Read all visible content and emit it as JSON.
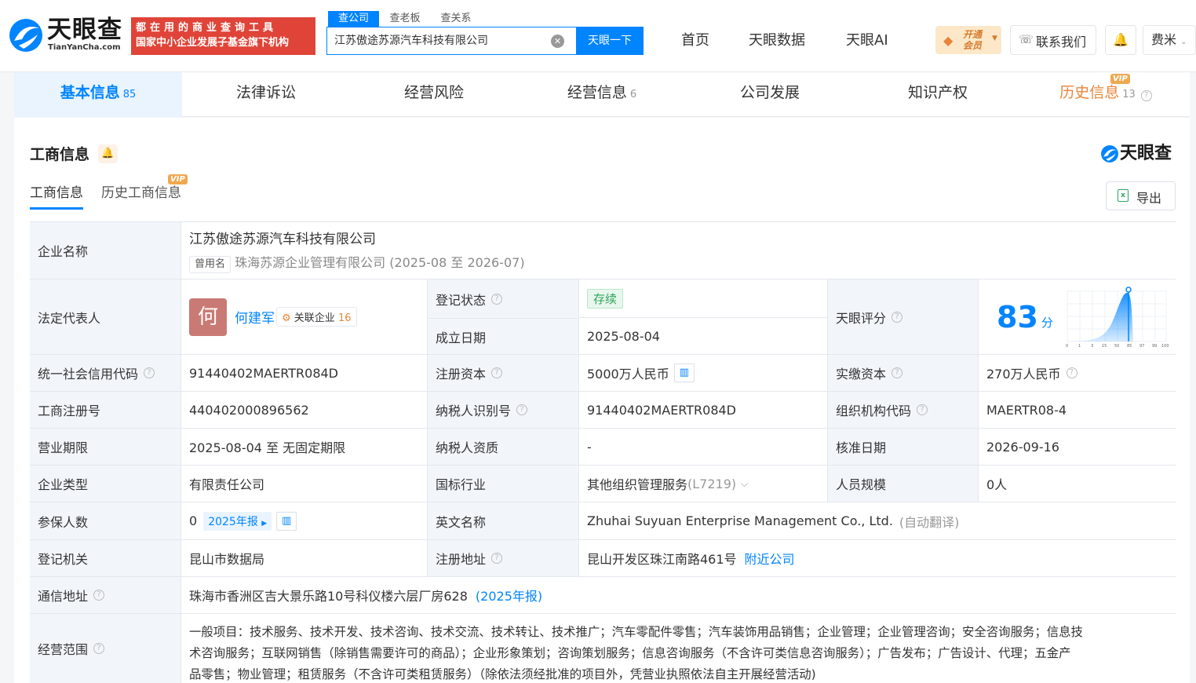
{
  "header": {
    "logo_cn": "天眼查",
    "logo_en": "TianYanCha.com",
    "slogan_line1": "都在用的商业查询工具",
    "slogan_line2": "国家中小企业发展子基金旗下机构",
    "search_tabs": [
      "查公司",
      "查老板",
      "查关系"
    ],
    "search_value": "江苏傲途苏源汽车科技有限公司",
    "search_button": "天眼一下",
    "nav": [
      "首页",
      "天眼数据",
      "天眼AI"
    ],
    "vip_label_1": "开通",
    "vip_label_2": "会员",
    "contact": "联系我们",
    "user": "费米"
  },
  "main_tabs": [
    {
      "label": "基本信息",
      "count": "85"
    },
    {
      "label": "法律诉讼",
      "count": ""
    },
    {
      "label": "经营风险",
      "count": ""
    },
    {
      "label": "经营信息",
      "count": "6"
    },
    {
      "label": "公司发展",
      "count": ""
    },
    {
      "label": "知识产权",
      "count": ""
    },
    {
      "label": "历史信息",
      "count": "13"
    }
  ],
  "vip_badge": "VIP",
  "section": {
    "title": "工商信息",
    "logo_text": "天眼查",
    "subtabs": [
      "工商信息",
      "历史工商信息"
    ],
    "export": "导出"
  },
  "info": {
    "company_name_label": "企业名称",
    "company_name": "江苏傲途苏源汽车科技有限公司",
    "former_name_tag": "曾用名",
    "former_name": "珠海苏源企业管理有限公司 (2025-08 至 2026-07)",
    "legal_rep_label": "法定代表人",
    "legal_rep_avatar": "何",
    "legal_rep": "何建军",
    "related_label": "关联企业",
    "related_count": "16",
    "reg_status_label": "登记状态",
    "reg_status": "存续",
    "found_date_label": "成立日期",
    "found_date": "2025-08-04",
    "score_label": "天眼评分",
    "score": "83",
    "score_unit": "分",
    "score_ticks": [
      "0",
      "1",
      "3",
      "15",
      "50",
      "85",
      "97",
      "99",
      "100"
    ],
    "credit_code_label": "统一社会信用代码",
    "credit_code": "91440402MAERTR084D",
    "reg_capital_label": "注册资本",
    "reg_capital": "5000万人民币",
    "paid_capital_label": "实缴资本",
    "paid_capital": "270万人民币",
    "reg_no_label": "工商注册号",
    "reg_no": "440402000896562",
    "taxpayer_id_label": "纳税人识别号",
    "taxpayer_id": "91440402MAERTR084D",
    "org_code_label": "组织机构代码",
    "org_code": "MAERTR08-4",
    "term_label": "营业期限",
    "term": "2025-08-04 至 无固定期限",
    "taxpayer_qual_label": "纳税人资质",
    "taxpayer_qual": "-",
    "approve_date_label": "核准日期",
    "approve_date": "2026-09-16",
    "type_label": "企业类型",
    "type": "有限责任公司",
    "industry_label": "国标行业",
    "industry": "其他组织管理服务",
    "industry_code": "(L7219)",
    "staff_label": "人员规模",
    "staff": "0人",
    "insured_label": "参保人数",
    "insured": "0",
    "insured_report": "2025年报",
    "en_name_label": "英文名称",
    "en_name": "Zhuhai Suyuan Enterprise Management Co., Ltd.",
    "en_name_note": "(自动翻译)",
    "authority_label": "登记机关",
    "authority": "昆山市数据局",
    "reg_addr_label": "注册地址",
    "reg_addr": "昆山开发区珠江南路461号",
    "nearby": "附近公司",
    "mail_addr_label": "通信地址",
    "mail_addr": "珠海市香洲区吉大景乐路10号科仪楼六层厂房628",
    "mail_addr_note": "(2025年报)",
    "scope_label": "经营范围",
    "scope_line1": "一般项目：技术服务、技术开发、技术咨询、技术交流、技术转让、技术推广；汽车零配件零售；汽车装饰用品销售；企业管理；企业管理咨询；安全咨询服务；信息技",
    "scope_line2": "术咨询服务；互联网销售（除销售需要许可的商品）；企业形象策划；咨询策划服务；信息咨询服务（不含许可类信息咨询服务）；广告发布；广告设计、代理；五金产",
    "scope_line3": "品零售；物业管理；租赁服务（不含许可类租赁服务）（除依法须经批准的项目外，凭营业执照依法自主开展经营活动)"
  }
}
